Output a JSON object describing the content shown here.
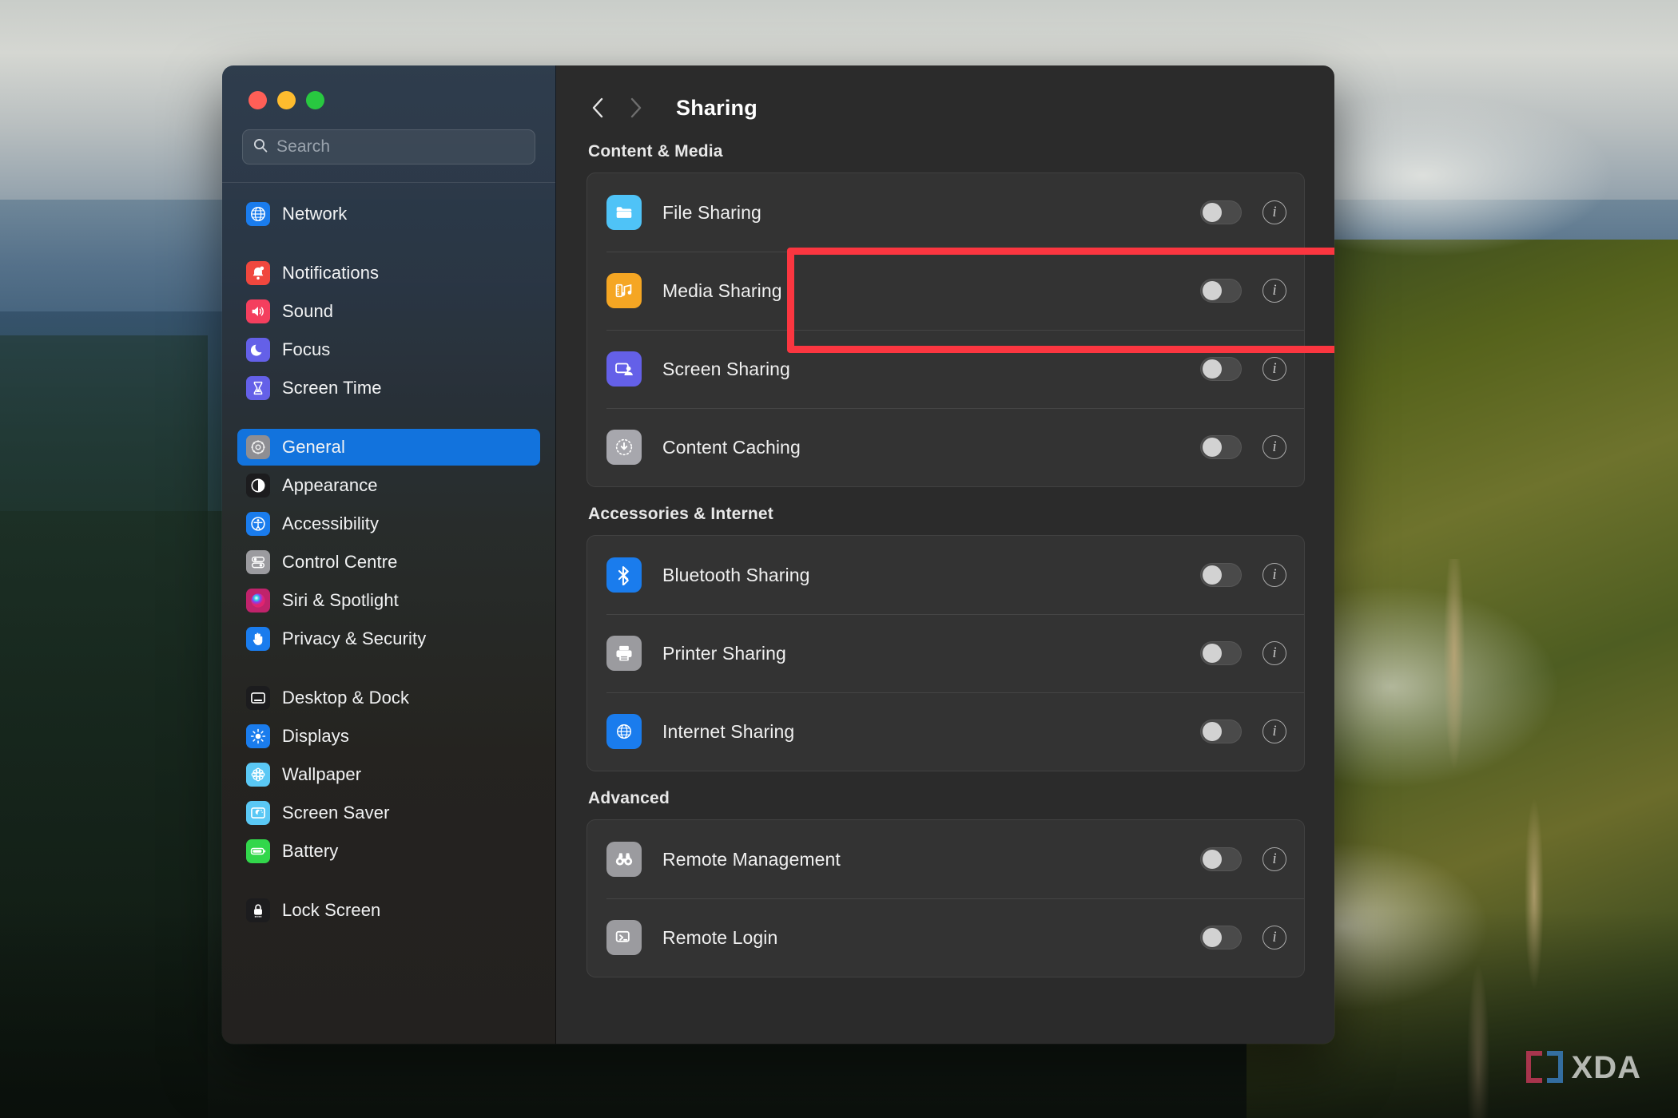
{
  "window": {
    "traffic_lights": [
      {
        "name": "close",
        "color": "#ff5f57"
      },
      {
        "name": "minimize",
        "color": "#febc2e"
      },
      {
        "name": "maximize",
        "color": "#28c840"
      }
    ]
  },
  "search": {
    "placeholder": "Search",
    "value": "",
    "icon": "search-icon"
  },
  "sidebar": {
    "groups": [
      {
        "items": [
          {
            "label": "Network",
            "icon": "globe-icon",
            "color": "#1a7ced",
            "selected": false
          }
        ]
      },
      {
        "items": [
          {
            "label": "Notifications",
            "icon": "bell-icon",
            "color": "#f0473e",
            "selected": false
          },
          {
            "label": "Sound",
            "icon": "speaker-icon",
            "color": "#f43f5e",
            "selected": false
          },
          {
            "label": "Focus",
            "icon": "moon-icon",
            "color": "#6460e8",
            "selected": false
          },
          {
            "label": "Screen Time",
            "icon": "hourglass-icon",
            "color": "#6460e8",
            "selected": false
          }
        ]
      },
      {
        "items": [
          {
            "label": "General",
            "icon": "gear-icon",
            "color": "#8e8e93",
            "selected": true
          },
          {
            "label": "Appearance",
            "icon": "appearance-icon",
            "color": "#1c1c1e",
            "selected": false
          },
          {
            "label": "Accessibility",
            "icon": "accessibility-icon",
            "color": "#1a7ced",
            "selected": false
          },
          {
            "label": "Control Centre",
            "icon": "control-centre-icon",
            "color": "#9b9b9f",
            "selected": false
          },
          {
            "label": "Siri & Spotlight",
            "icon": "siri-icon",
            "color": "#c0236b",
            "selected": false
          },
          {
            "label": "Privacy & Security",
            "icon": "hand-icon",
            "color": "#1a7ced",
            "selected": false
          }
        ]
      },
      {
        "items": [
          {
            "label": "Desktop & Dock",
            "icon": "desktop-dock-icon",
            "color": "#1c1c1e",
            "selected": false
          },
          {
            "label": "Displays",
            "icon": "brightness-icon",
            "color": "#1a7ced",
            "selected": false
          },
          {
            "label": "Wallpaper",
            "icon": "wallpaper-icon",
            "color": "#5ac8f5",
            "selected": false
          },
          {
            "label": "Screen Saver",
            "icon": "screen-saver-icon",
            "color": "#5ac8f5",
            "selected": false
          },
          {
            "label": "Battery",
            "icon": "battery-icon",
            "color": "#32d74b",
            "selected": false
          }
        ]
      },
      {
        "items": [
          {
            "label": "Lock Screen",
            "icon": "lock-icon",
            "color": "#1c1c1e",
            "selected": false
          }
        ]
      }
    ]
  },
  "header": {
    "back_icon": "chevron-left-icon",
    "forward_icon": "chevron-right-icon",
    "title": "Sharing"
  },
  "sections": [
    {
      "title": "Content & Media",
      "rows": [
        {
          "label": "File Sharing",
          "icon": "folder-icon",
          "color": "#4fc3f7",
          "toggle": "off",
          "info": "i"
        },
        {
          "label": "Media Sharing",
          "icon": "media-icon",
          "color": "#f5a623",
          "toggle": "off",
          "info": "i"
        },
        {
          "label": "Screen Sharing",
          "icon": "screen-share-icon",
          "color": "#6460e8",
          "toggle": "off",
          "info": "i"
        },
        {
          "label": "Content Caching",
          "icon": "download-arrow-icon",
          "color": "#a7a7ad",
          "toggle": "off",
          "info": "i"
        }
      ]
    },
    {
      "title": "Accessories & Internet",
      "rows": [
        {
          "label": "Bluetooth Sharing",
          "icon": "bluetooth-icon",
          "color": "#1a7ced",
          "toggle": "off",
          "info": "i"
        },
        {
          "label": "Printer Sharing",
          "icon": "printer-icon",
          "color": "#9b9b9f",
          "toggle": "off",
          "info": "i"
        },
        {
          "label": "Internet Sharing",
          "icon": "globe-icon",
          "color": "#1a7ced",
          "toggle": "off",
          "info": "i"
        }
      ]
    },
    {
      "title": "Advanced",
      "rows": [
        {
          "label": "Remote Management",
          "icon": "binoculars-icon",
          "color": "#9b9b9f",
          "toggle": "off",
          "info": "i"
        },
        {
          "label": "Remote Login",
          "icon": "remote-login-icon",
          "color": "#9b9b9f",
          "toggle": "off",
          "info": "i"
        }
      ]
    }
  ],
  "annotation": {
    "target": "File Sharing",
    "color": "#fb3640"
  },
  "watermark": {
    "text": "XDA",
    "bracket_left_color": "#c8395a",
    "bracket_right_color": "#3a7fc0"
  }
}
